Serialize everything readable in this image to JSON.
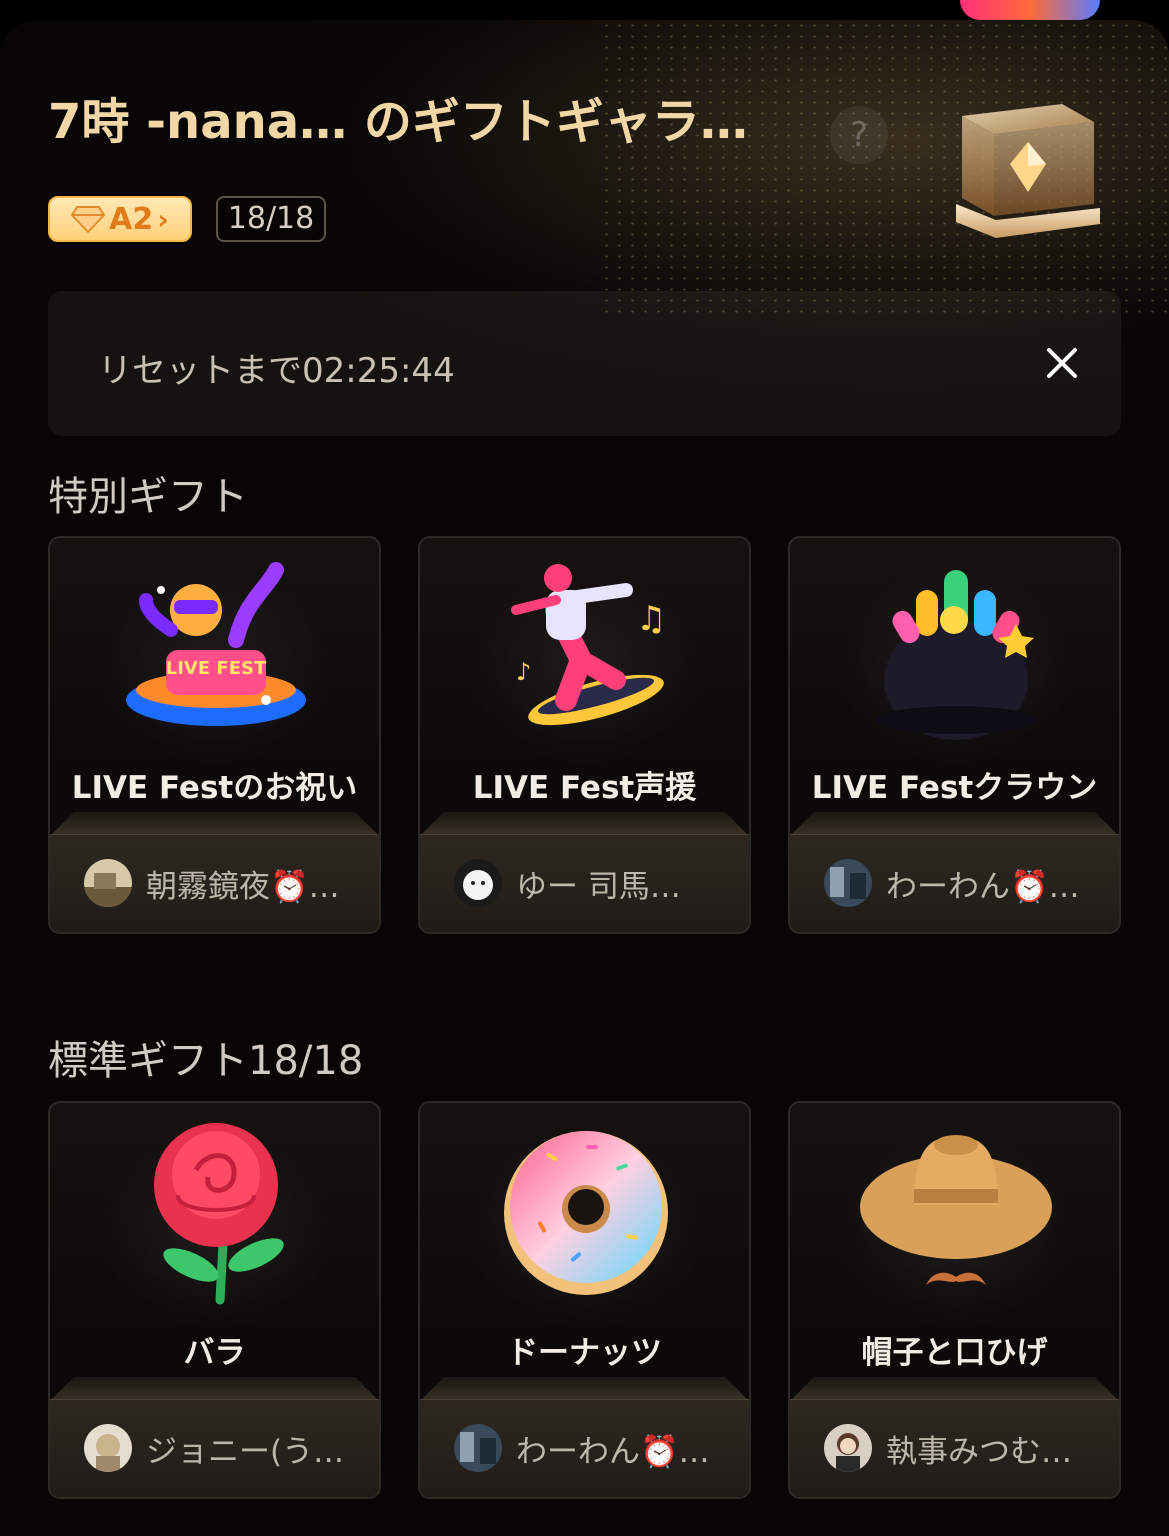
{
  "header": {
    "title": "7時 -nana… のギフトギャラ…",
    "help_label": "?",
    "level_badge": "A2",
    "count_badge": "18/18"
  },
  "reset": {
    "text": "リセットまで02:25:44"
  },
  "special_section": {
    "title": "特別ギフト",
    "gifts": [
      {
        "name": "LIVE Festのお祝い",
        "sender": "朝霧鏡夜⏰…",
        "icon": "live-fest-celebration-icon"
      },
      {
        "name": "LIVE Fest声援",
        "sender": "ゆー 司馬…",
        "icon": "live-fest-cheer-icon"
      },
      {
        "name": "LIVE Festクラウン",
        "sender": "わーわん⏰…",
        "icon": "live-fest-crown-icon"
      }
    ]
  },
  "standard_section": {
    "title": "標準ギフト18/18",
    "gifts": [
      {
        "name": "バラ",
        "sender": "ジョニー(う…",
        "icon": "rose-icon"
      },
      {
        "name": "ドーナッツ",
        "sender": "わーわん⏰…",
        "icon": "donut-icon"
      },
      {
        "name": "帽子と口ひげ",
        "sender": "執事みつむ…",
        "icon": "hat-mustache-icon"
      }
    ]
  },
  "colors": {
    "title": "#f2d7a6",
    "badge_orange": "#e07b1c",
    "background": "#0b0908"
  }
}
